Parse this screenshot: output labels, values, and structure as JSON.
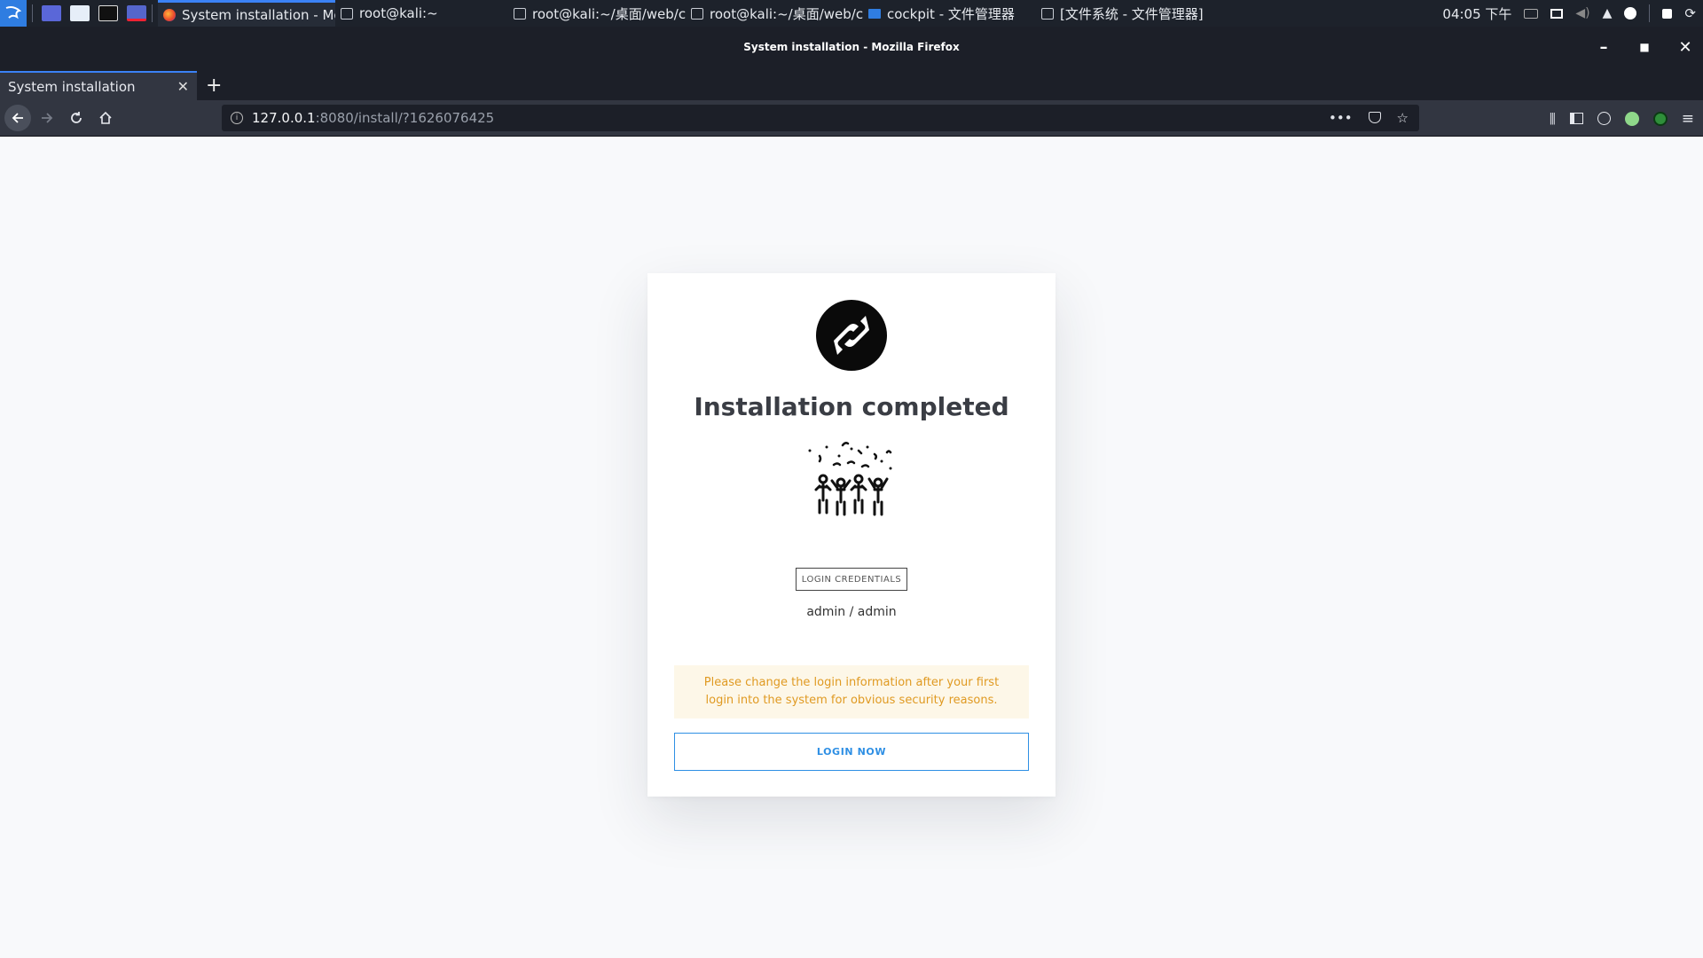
{
  "taskbar": {
    "tasks": [
      {
        "label": "System installation - Mo...",
        "active": true
      },
      {
        "label": "root@kali:~",
        "active": false
      },
      {
        "label": "root@kali:~/桌面/web/c...",
        "active": false
      },
      {
        "label": "root@kali:~/桌面/web/c...",
        "active": false
      },
      {
        "label": "cockpit - 文件管理器",
        "active": false
      },
      {
        "label": "[文件系统 - 文件管理器]",
        "active": false
      }
    ],
    "clock": "04:05 下午"
  },
  "window": {
    "title": "System installation - Mozilla Firefox"
  },
  "browser": {
    "tab_title": "System installation",
    "url_host": "127.0.0.1",
    "url_path": ":8080/install/?1626076425",
    "more_icon": "•••"
  },
  "page": {
    "heading": "Installation completed",
    "badge": "LOGIN CREDENTIALS",
    "credentials": "admin / admin",
    "alert": "Please change the login information after your first login into the system for obvious security reasons.",
    "login_button": "LOGIN NOW"
  },
  "colors": {
    "accent": "#2e8fe4",
    "alert_text": "#e09a22",
    "alert_bg": "#fdf7e8"
  }
}
